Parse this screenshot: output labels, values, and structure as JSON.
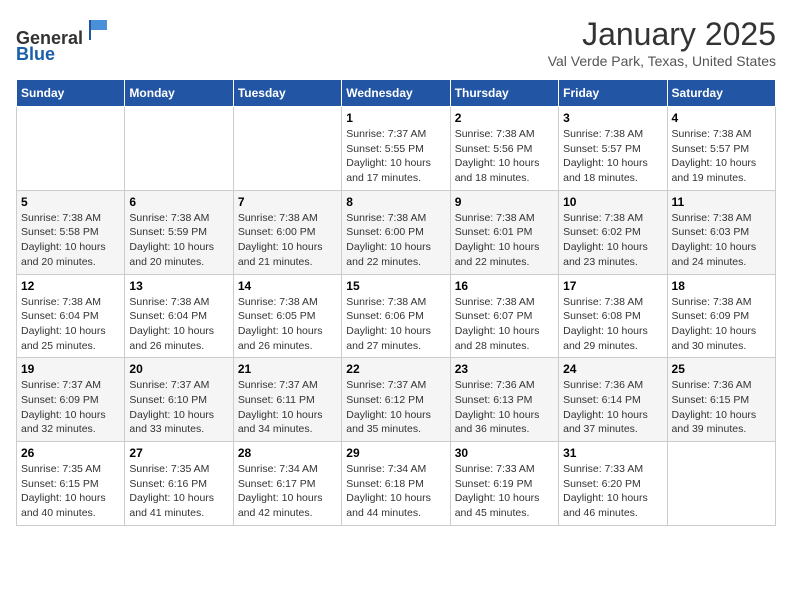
{
  "header": {
    "logo_line1": "General",
    "logo_line2": "Blue",
    "title": "January 2025",
    "subtitle": "Val Verde Park, Texas, United States"
  },
  "weekdays": [
    "Sunday",
    "Monday",
    "Tuesday",
    "Wednesday",
    "Thursday",
    "Friday",
    "Saturday"
  ],
  "weeks": [
    [
      {
        "num": "",
        "info": ""
      },
      {
        "num": "",
        "info": ""
      },
      {
        "num": "",
        "info": ""
      },
      {
        "num": "1",
        "info": "Sunrise: 7:37 AM\nSunset: 5:55 PM\nDaylight: 10 hours\nand 17 minutes."
      },
      {
        "num": "2",
        "info": "Sunrise: 7:38 AM\nSunset: 5:56 PM\nDaylight: 10 hours\nand 18 minutes."
      },
      {
        "num": "3",
        "info": "Sunrise: 7:38 AM\nSunset: 5:57 PM\nDaylight: 10 hours\nand 18 minutes."
      },
      {
        "num": "4",
        "info": "Sunrise: 7:38 AM\nSunset: 5:57 PM\nDaylight: 10 hours\nand 19 minutes."
      }
    ],
    [
      {
        "num": "5",
        "info": "Sunrise: 7:38 AM\nSunset: 5:58 PM\nDaylight: 10 hours\nand 20 minutes."
      },
      {
        "num": "6",
        "info": "Sunrise: 7:38 AM\nSunset: 5:59 PM\nDaylight: 10 hours\nand 20 minutes."
      },
      {
        "num": "7",
        "info": "Sunrise: 7:38 AM\nSunset: 6:00 PM\nDaylight: 10 hours\nand 21 minutes."
      },
      {
        "num": "8",
        "info": "Sunrise: 7:38 AM\nSunset: 6:00 PM\nDaylight: 10 hours\nand 22 minutes."
      },
      {
        "num": "9",
        "info": "Sunrise: 7:38 AM\nSunset: 6:01 PM\nDaylight: 10 hours\nand 22 minutes."
      },
      {
        "num": "10",
        "info": "Sunrise: 7:38 AM\nSunset: 6:02 PM\nDaylight: 10 hours\nand 23 minutes."
      },
      {
        "num": "11",
        "info": "Sunrise: 7:38 AM\nSunset: 6:03 PM\nDaylight: 10 hours\nand 24 minutes."
      }
    ],
    [
      {
        "num": "12",
        "info": "Sunrise: 7:38 AM\nSunset: 6:04 PM\nDaylight: 10 hours\nand 25 minutes."
      },
      {
        "num": "13",
        "info": "Sunrise: 7:38 AM\nSunset: 6:04 PM\nDaylight: 10 hours\nand 26 minutes."
      },
      {
        "num": "14",
        "info": "Sunrise: 7:38 AM\nSunset: 6:05 PM\nDaylight: 10 hours\nand 26 minutes."
      },
      {
        "num": "15",
        "info": "Sunrise: 7:38 AM\nSunset: 6:06 PM\nDaylight: 10 hours\nand 27 minutes."
      },
      {
        "num": "16",
        "info": "Sunrise: 7:38 AM\nSunset: 6:07 PM\nDaylight: 10 hours\nand 28 minutes."
      },
      {
        "num": "17",
        "info": "Sunrise: 7:38 AM\nSunset: 6:08 PM\nDaylight: 10 hours\nand 29 minutes."
      },
      {
        "num": "18",
        "info": "Sunrise: 7:38 AM\nSunset: 6:09 PM\nDaylight: 10 hours\nand 30 minutes."
      }
    ],
    [
      {
        "num": "19",
        "info": "Sunrise: 7:37 AM\nSunset: 6:09 PM\nDaylight: 10 hours\nand 32 minutes."
      },
      {
        "num": "20",
        "info": "Sunrise: 7:37 AM\nSunset: 6:10 PM\nDaylight: 10 hours\nand 33 minutes."
      },
      {
        "num": "21",
        "info": "Sunrise: 7:37 AM\nSunset: 6:11 PM\nDaylight: 10 hours\nand 34 minutes."
      },
      {
        "num": "22",
        "info": "Sunrise: 7:37 AM\nSunset: 6:12 PM\nDaylight: 10 hours\nand 35 minutes."
      },
      {
        "num": "23",
        "info": "Sunrise: 7:36 AM\nSunset: 6:13 PM\nDaylight: 10 hours\nand 36 minutes."
      },
      {
        "num": "24",
        "info": "Sunrise: 7:36 AM\nSunset: 6:14 PM\nDaylight: 10 hours\nand 37 minutes."
      },
      {
        "num": "25",
        "info": "Sunrise: 7:36 AM\nSunset: 6:15 PM\nDaylight: 10 hours\nand 39 minutes."
      }
    ],
    [
      {
        "num": "26",
        "info": "Sunrise: 7:35 AM\nSunset: 6:15 PM\nDaylight: 10 hours\nand 40 minutes."
      },
      {
        "num": "27",
        "info": "Sunrise: 7:35 AM\nSunset: 6:16 PM\nDaylight: 10 hours\nand 41 minutes."
      },
      {
        "num": "28",
        "info": "Sunrise: 7:34 AM\nSunset: 6:17 PM\nDaylight: 10 hours\nand 42 minutes."
      },
      {
        "num": "29",
        "info": "Sunrise: 7:34 AM\nSunset: 6:18 PM\nDaylight: 10 hours\nand 44 minutes."
      },
      {
        "num": "30",
        "info": "Sunrise: 7:33 AM\nSunset: 6:19 PM\nDaylight: 10 hours\nand 45 minutes."
      },
      {
        "num": "31",
        "info": "Sunrise: 7:33 AM\nSunset: 6:20 PM\nDaylight: 10 hours\nand 46 minutes."
      },
      {
        "num": "",
        "info": ""
      }
    ]
  ]
}
